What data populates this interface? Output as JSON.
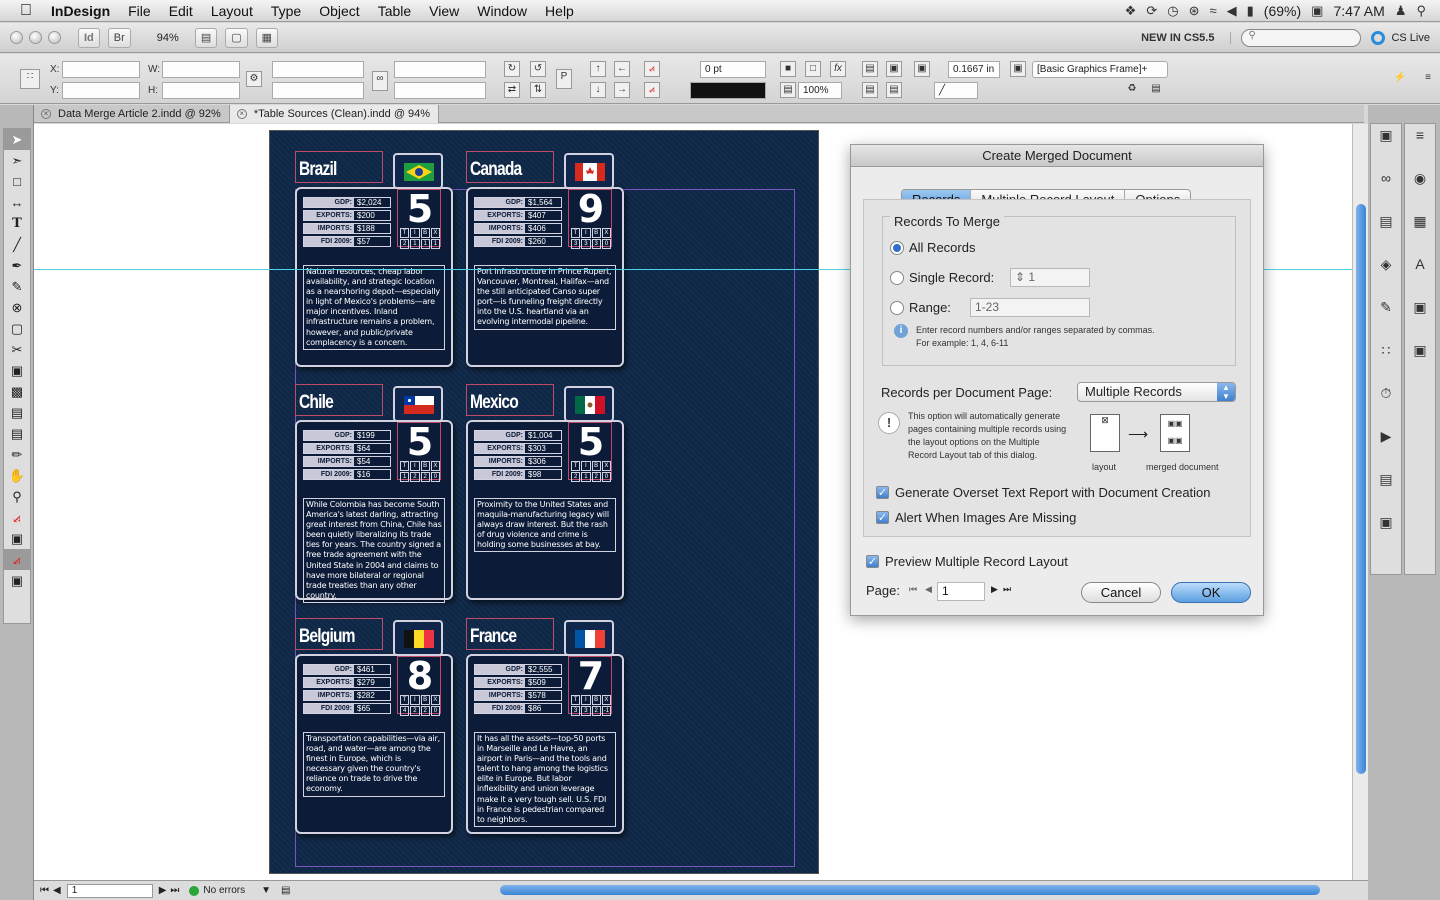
{
  "menubar": {
    "app": "InDesign",
    "items": [
      "File",
      "Edit",
      "Layout",
      "Type",
      "Object",
      "Table",
      "View",
      "Window",
      "Help"
    ],
    "battery": "(69%)",
    "clock": "7:47 AM"
  },
  "appbar": {
    "br": "Br",
    "zoom": "94%",
    "new_in": "NEW IN CS5.5",
    "cs_live": "CS Live"
  },
  "control": {
    "x_label": "X:",
    "y_label": "Y:",
    "w_label": "W:",
    "h_label": "H:",
    "stroke": "0 pt",
    "opacity": "100%",
    "offset": "0.1667 in",
    "style": "[Basic Graphics Frame]+"
  },
  "tabs": [
    {
      "label": "Data Merge Article 2.indd @ 92%"
    },
    {
      "label": "*Table Sources (Clean).indd @ 94%"
    }
  ],
  "stat_labels": [
    "GDP:",
    "EXPORTS:",
    "IMPORTS:",
    "FDI 2009:"
  ],
  "tibx_labels": [
    "T",
    "I",
    "B",
    "X"
  ],
  "cards": [
    {
      "name": "Brazil",
      "number": "5",
      "flag": "brazil",
      "tibx": [
        "2",
        "1",
        "1",
        "1"
      ],
      "gdp": "$2,024",
      "exports": "$200",
      "imports": "$188",
      "fdi": "$57",
      "desc": "Natural resources, cheap labor availability, and strategic location as a nearshoring depot—especially in light of Mexico's problems—are major incentives. Inland infrastructure remains a problem, however, and public/private complacency is a concern."
    },
    {
      "name": "Canada",
      "number": "9",
      "flag": "canada",
      "tibx": [
        "3",
        "3",
        "3",
        "0"
      ],
      "gdp": "$1,564",
      "exports": "$407",
      "imports": "$406",
      "fdi": "$260",
      "desc": "Port infrastructure in Prince Rupert, Vancouver, Montreal, Halifax—and the still anticipated Canso super port—is funneling freight directly into the U.S. heartland via an evolving intermodal pipeline."
    },
    {
      "name": "Chile",
      "number": "5",
      "flag": "chile",
      "tibx": [
        "1",
        "2",
        "2",
        "0"
      ],
      "gdp": "$199",
      "exports": "$64",
      "imports": "$54",
      "fdi": "$16",
      "desc": "While Colombia has become South America's latest darling, attracting great interest from China, Chile has been quietly liberalizing its trade ties for years. The country signed a free trade agreement with the United State in 2004 and claims to have more bilateral or regional trade treaties than any other country."
    },
    {
      "name": "Mexico",
      "number": "5",
      "flag": "mexico",
      "tibx": [
        "2",
        "1",
        "2",
        "0"
      ],
      "gdp": "$1,004",
      "exports": "$303",
      "imports": "$306",
      "fdi": "$98",
      "desc": "Proximity to the United States and maquila-manufacturing legacy will always draw interest. But the rash of drug violence and crime is holding some businesses at bay."
    },
    {
      "name": "Belgium",
      "number": "8",
      "flag": "belgium",
      "tibx": [
        "4",
        "2",
        "2",
        "0"
      ],
      "gdp": "$461",
      "exports": "$279",
      "imports": "$282",
      "fdi": "$65",
      "desc": "Transportation capabilities—via air, road, and water—are among the finest in Europe, which is necessary given the country's reliance on trade to drive the economy."
    },
    {
      "name": "France",
      "number": "7",
      "flag": "france",
      "tibx": [
        "3",
        "3",
        "2",
        "-1"
      ],
      "gdp": "$2,555",
      "exports": "$509",
      "imports": "$578",
      "fdi": "$86",
      "desc": "It has all the assets—top-50 ports in Marseille and Le Havre, an airport in Paris—and the tools and talent to hang among the logistics elite in Europe. But labor inflexibility and union leverage make it a very tough sell. U.S. FDI in France is pedestrian compared to neighbors."
    }
  ],
  "dialog": {
    "title": "Create Merged Document",
    "tabs": [
      "Records",
      "Multiple Record Layout",
      "Options"
    ],
    "group_title": "Records To Merge",
    "all_records": "All Records",
    "single_record": "Single Record:",
    "single_value": "1",
    "range": "Range:",
    "range_value": "1-23",
    "hint": "Enter record numbers and/or ranges separated by commas. For example: 1, 4, 6-11",
    "per_page_label": "Records per Document Page:",
    "per_page_value": "Multiple Records",
    "info": "This option will automatically generate pages containing multiple records using the layout options on the Multiple Record Layout tab of this dialog.",
    "layout_cap": "layout",
    "merged_cap": "merged document",
    "overset": "Generate Overset Text Report with Document Creation",
    "alert": "Alert When Images Are Missing",
    "preview": "Preview Multiple Record Layout",
    "page_label": "Page:",
    "page_value": "1",
    "cancel": "Cancel",
    "ok": "OK"
  },
  "statusbar": {
    "page": "1",
    "errors": "No errors"
  },
  "colors": {
    "page_bg": "#0f2747",
    "accent": "#3a84d6",
    "frame_pink": "#c04a6a"
  }
}
